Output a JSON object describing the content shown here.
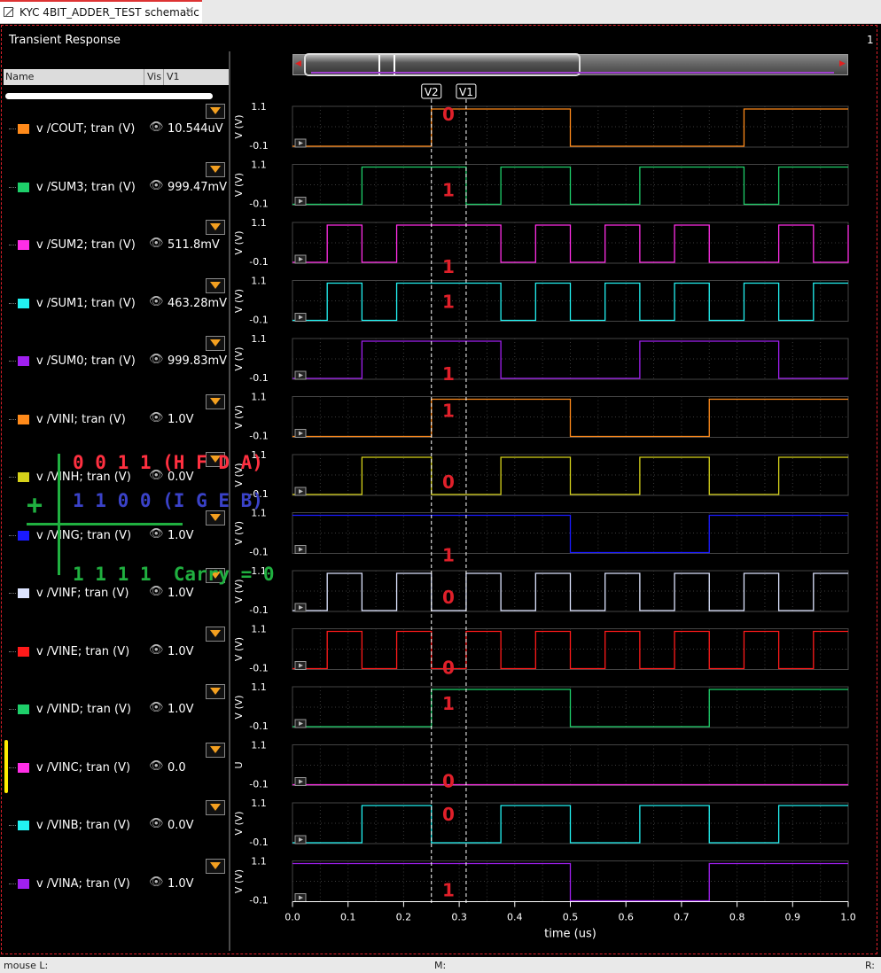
{
  "tab": {
    "title": "KYC 4BIT_ADDER_TEST schematic",
    "close": "✕"
  },
  "panel": {
    "title": "Transient Response",
    "corner": "1"
  },
  "table_header": {
    "name": "Name",
    "vis": "Vis",
    "v1": "V1"
  },
  "signals": [
    {
      "name": "v /COUT; tran (V)",
      "value": "10.544uV",
      "color": "#ff8a1a",
      "ylabel": "V (V)",
      "digit": "0"
    },
    {
      "name": "v /SUM3; tran (V)",
      "value": "999.47mV",
      "color": "#1ecf6a",
      "ylabel": "V (V)",
      "digit": "1"
    },
    {
      "name": "v /SUM2; tran (V)",
      "value": "511.8mV",
      "color": "#ff2ee6",
      "ylabel": "V (V)",
      "digit": "1"
    },
    {
      "name": "v /SUM1; tran (V)",
      "value": "463.28mV",
      "color": "#22f2f2",
      "ylabel": "V (V)",
      "digit": "1"
    },
    {
      "name": "v /SUM0; tran (V)",
      "value": "999.83mV",
      "color": "#a020f0",
      "ylabel": "V (V)",
      "digit": "1"
    },
    {
      "name": "v /VINI; tran (V)",
      "value": "1.0V",
      "color": "#ff8a1a",
      "ylabel": "V (V)",
      "digit": "1"
    },
    {
      "name": "v /VINH; tran (V)",
      "value": "0.0V",
      "color": "#d6d21a",
      "ylabel": "V (V)",
      "digit": "0"
    },
    {
      "name": "v /VING; tran (V)",
      "value": "1.0V",
      "color": "#1a1aff",
      "ylabel": "V (V)",
      "digit": "1"
    },
    {
      "name": "v /VINF; tran (V)",
      "value": "1.0V",
      "color": "#dde4ff",
      "ylabel": "V (V)",
      "digit": "0"
    },
    {
      "name": "v /VINE; tran (V)",
      "value": "1.0V",
      "color": "#ff1a1a",
      "ylabel": "V (V)",
      "digit": "0"
    },
    {
      "name": "v /VIND; tran (V)",
      "value": "1.0V",
      "color": "#1ecf6a",
      "ylabel": "V (V)",
      "digit": "1"
    },
    {
      "name": "v /VINC; tran (V)",
      "value": "0.0",
      "color": "#ff2ee6",
      "ylabel": "U",
      "digit": "0"
    },
    {
      "name": "v /VINB; tran (V)",
      "value": "0.0V",
      "color": "#22f2f2",
      "ylabel": "V (V)",
      "digit": "0"
    },
    {
      "name": "v /VINA; tran (V)",
      "value": "1.0V",
      "color": "#a020f0",
      "ylabel": "V (V)",
      "digit": "1"
    }
  ],
  "annotations": {
    "line1": "0 0 1 1 (H F D A)",
    "line2": "1 1 0 0 (I G E B)",
    "line3": "1 1 1 1  Carry = 0",
    "plus": "+"
  },
  "cursors": {
    "v2": "V2",
    "v1": "V1"
  },
  "chart_data": {
    "type": "line",
    "title": "Transient Response",
    "xlabel": "time (us)",
    "ylabel": "V (V)",
    "xlim": [
      0.0,
      1.0
    ],
    "ylim": [
      -0.1,
      1.1
    ],
    "x_ticks": [
      "0.0",
      "0.1",
      "0.2",
      "0.3",
      "0.4",
      "0.5",
      "0.6",
      "0.7",
      "0.8",
      "0.9",
      "1.0"
    ],
    "y_ticks": [
      "1.1",
      "-0.1"
    ],
    "cursor_x": {
      "V2": 0.25,
      "V1": 0.3125
    },
    "series": [
      {
        "name": "v /COUT; tran (V)",
        "t": [
          0,
          0.25,
          0.5,
          0.8125,
          1.0
        ],
        "v": [
          0,
          1,
          0,
          1,
          1
        ]
      },
      {
        "name": "v /SUM3; tran (V)",
        "t": [
          0,
          0.125,
          0.3125,
          0.375,
          0.5,
          0.625,
          0.8125,
          0.875,
          1.0
        ],
        "v": [
          0,
          1,
          0,
          1,
          0,
          1,
          0,
          1,
          1
        ]
      },
      {
        "name": "v /SUM2; tran (V)",
        "t": [
          0,
          0.0625,
          0.125,
          0.1875,
          0.375,
          0.4375,
          0.5,
          0.5625,
          0.625,
          0.6875,
          0.75,
          0.875,
          0.9375,
          1.0
        ],
        "v": [
          0,
          1,
          0,
          1,
          0,
          1,
          0,
          1,
          0,
          1,
          0,
          1,
          0,
          1
        ]
      },
      {
        "name": "v /SUM1; tran (V)",
        "t": [
          0,
          0.0625,
          0.125,
          0.1875,
          0.375,
          0.4375,
          0.5,
          0.5625,
          0.625,
          0.6875,
          0.75,
          0.8125,
          0.875,
          0.9375,
          1.0
        ],
        "v": [
          0,
          1,
          0,
          1,
          0,
          1,
          0,
          1,
          0,
          1,
          0,
          1,
          0,
          1,
          1
        ]
      },
      {
        "name": "v /SUM0; tran (V)",
        "t": [
          0,
          0.125,
          0.375,
          0.625,
          0.875,
          1.0
        ],
        "v": [
          0,
          1,
          0,
          1,
          0,
          0
        ]
      },
      {
        "name": "v /VINI; tran (V)",
        "t": [
          0,
          0.25,
          0.5,
          0.75,
          1.0
        ],
        "v": [
          0,
          1,
          0,
          1,
          1
        ]
      },
      {
        "name": "v /VINH; tran (V)",
        "t": [
          0,
          0.125,
          0.25,
          0.375,
          0.5,
          0.625,
          0.75,
          0.875,
          1.0
        ],
        "v": [
          0,
          1,
          0,
          1,
          0,
          1,
          0,
          1,
          1
        ]
      },
      {
        "name": "v /VING; tran (V)",
        "t": [
          0,
          0.5,
          0.75,
          1.0
        ],
        "v": [
          1,
          0,
          1,
          1
        ]
      },
      {
        "name": "v /VINF; tran (V)",
        "t": [
          0,
          0.0625,
          0.125,
          0.1875,
          0.25,
          0.3125,
          0.375,
          0.4375,
          0.5,
          0.5625,
          0.625,
          0.6875,
          0.75,
          0.8125,
          0.875,
          0.9375,
          1.0
        ],
        "v": [
          0,
          1,
          0,
          1,
          0,
          1,
          0,
          1,
          0,
          1,
          0,
          1,
          0,
          1,
          0,
          1,
          1
        ]
      },
      {
        "name": "v /VINE; tran (V)",
        "t": [
          0,
          0.0625,
          0.125,
          0.1875,
          0.25,
          0.3125,
          0.375,
          0.4375,
          0.5,
          0.5625,
          0.625,
          0.6875,
          0.75,
          0.8125,
          0.875,
          0.9375,
          1.0
        ],
        "v": [
          0,
          1,
          0,
          1,
          0,
          1,
          0,
          1,
          0,
          1,
          0,
          1,
          0,
          1,
          0,
          1,
          1
        ]
      },
      {
        "name": "v /VIND; tran (V)",
        "t": [
          0,
          0.25,
          0.5,
          0.75,
          1.0
        ],
        "v": [
          0,
          1,
          0,
          1,
          1
        ]
      },
      {
        "name": "v /VINC; tran (V)",
        "t": [
          0,
          1.0
        ],
        "v": [
          0,
          0
        ]
      },
      {
        "name": "v /VINB; tran (V)",
        "t": [
          0,
          0.125,
          0.25,
          0.375,
          0.5,
          0.625,
          0.75,
          0.875,
          1.0
        ],
        "v": [
          0,
          1,
          0,
          1,
          0,
          1,
          0,
          1,
          1
        ]
      },
      {
        "name": "v /VINA; tran (V)",
        "t": [
          0,
          0.5,
          0.75,
          1.0
        ],
        "v": [
          1,
          0,
          1,
          1
        ]
      }
    ]
  },
  "status": {
    "left": "mouse L:",
    "mid": "M:",
    "right": "R:"
  }
}
